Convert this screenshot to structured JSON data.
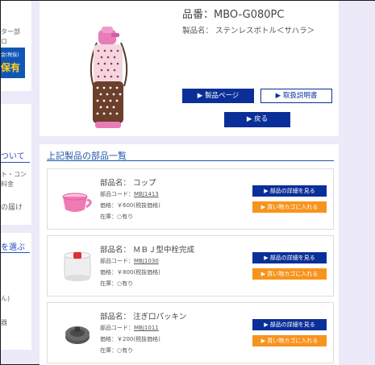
{
  "sidebar": {
    "fragment_1": "ター部",
    "fragment_2": "ロ",
    "banner_small": "金(税抜)",
    "banner_big": "保有",
    "link_1": "ついて",
    "fragment_3": "ト・コン",
    "fragment_4": "料金",
    "link_2": "の届け",
    "link_3": "を選ぶ",
    "fragment_5": "ん)",
    "fragment_6": "器"
  },
  "product": {
    "number_label": "品番：MBO-G080PC",
    "name_label": "製品名：",
    "name_value": "ステンレスボトル＜サハラ＞",
    "product_page_button": "▶ 製品ページ",
    "manual_button": "▶ 取扱説明書",
    "back_button": "▶ 戻る"
  },
  "parts": {
    "title": "上記製品の部品一覧",
    "detail_button": "▶ 部品の詳細を見る",
    "cart_button": "▶ 買い物カゴに入れる",
    "name_prefix": "部品名：",
    "code_prefix": "部品コード：",
    "price_prefix": "価格：",
    "stock_prefix": "在庫：",
    "items": [
      {
        "name": "コップ",
        "code": "MBJ1413",
        "price": "￥600(税抜価格)",
        "stock": "○有り"
      },
      {
        "name": "ＭＢＪ型中栓完成",
        "code": "MBJ1030",
        "price": "￥800(税抜価格)",
        "stock": "○有り"
      },
      {
        "name": "注ぎ口パッキン",
        "code": "MBJ1011",
        "price": "￥200(税抜価格)",
        "stock": "○有り"
      }
    ]
  },
  "colors": {
    "accent_blue": "#0b2f98",
    "cart_orange": "#f7941d",
    "title_blue": "#1d56a8",
    "page_bg": "#eceaf8"
  }
}
